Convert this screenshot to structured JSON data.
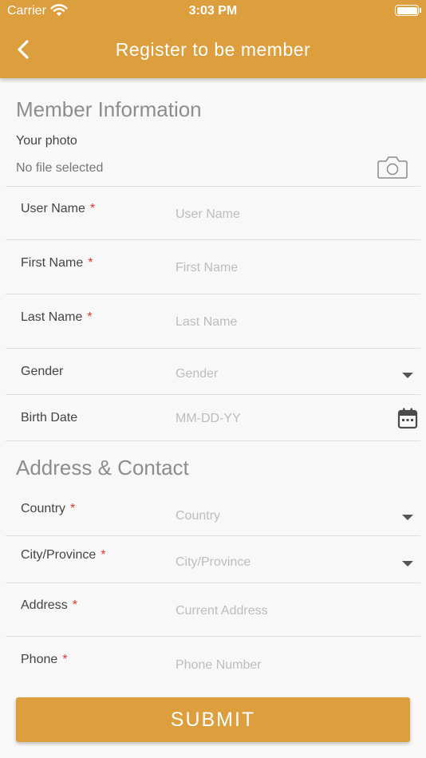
{
  "status_bar": {
    "carrier": "Carrier",
    "time": "3:03 PM"
  },
  "nav": {
    "title": "Register to be member",
    "back_icon": "chevron-left-icon"
  },
  "member_section": {
    "title": "Member Information",
    "photo_label": "Your photo",
    "photo_status": "No file selected",
    "camera_icon": "camera-icon"
  },
  "fields": {
    "username": {
      "label": "User Name",
      "required_mark": "*",
      "placeholder": "User Name",
      "value": ""
    },
    "firstname": {
      "label": "First Name",
      "required_mark": "*",
      "placeholder": "First Name",
      "value": ""
    },
    "lastname": {
      "label": "Last Name",
      "required_mark": "*",
      "placeholder": "Last Name",
      "value": ""
    },
    "gender": {
      "label": "Gender",
      "placeholder": "Gender",
      "value": ""
    },
    "birthdate": {
      "label": "Birth Date",
      "placeholder": "MM-DD-YY",
      "value": ""
    },
    "country": {
      "label": "Country",
      "required_mark": "*",
      "placeholder": "Country",
      "value": ""
    },
    "city": {
      "label": "City/Province",
      "required_mark": "*",
      "placeholder": "City/Province",
      "value": ""
    },
    "address": {
      "label": "Address",
      "required_mark": "*",
      "placeholder": "Current Address",
      "value": ""
    },
    "phone": {
      "label": "Phone",
      "required_mark": "*",
      "placeholder": "Phone Number",
      "value": ""
    }
  },
  "address_section": {
    "title": "Address & Contact"
  },
  "submit": {
    "label": "SUBMIT"
  },
  "colors": {
    "brand": "#dd9e3d",
    "required": "#e0362b",
    "placeholder": "#bdbdbd",
    "section_title": "#8d8d8d"
  }
}
